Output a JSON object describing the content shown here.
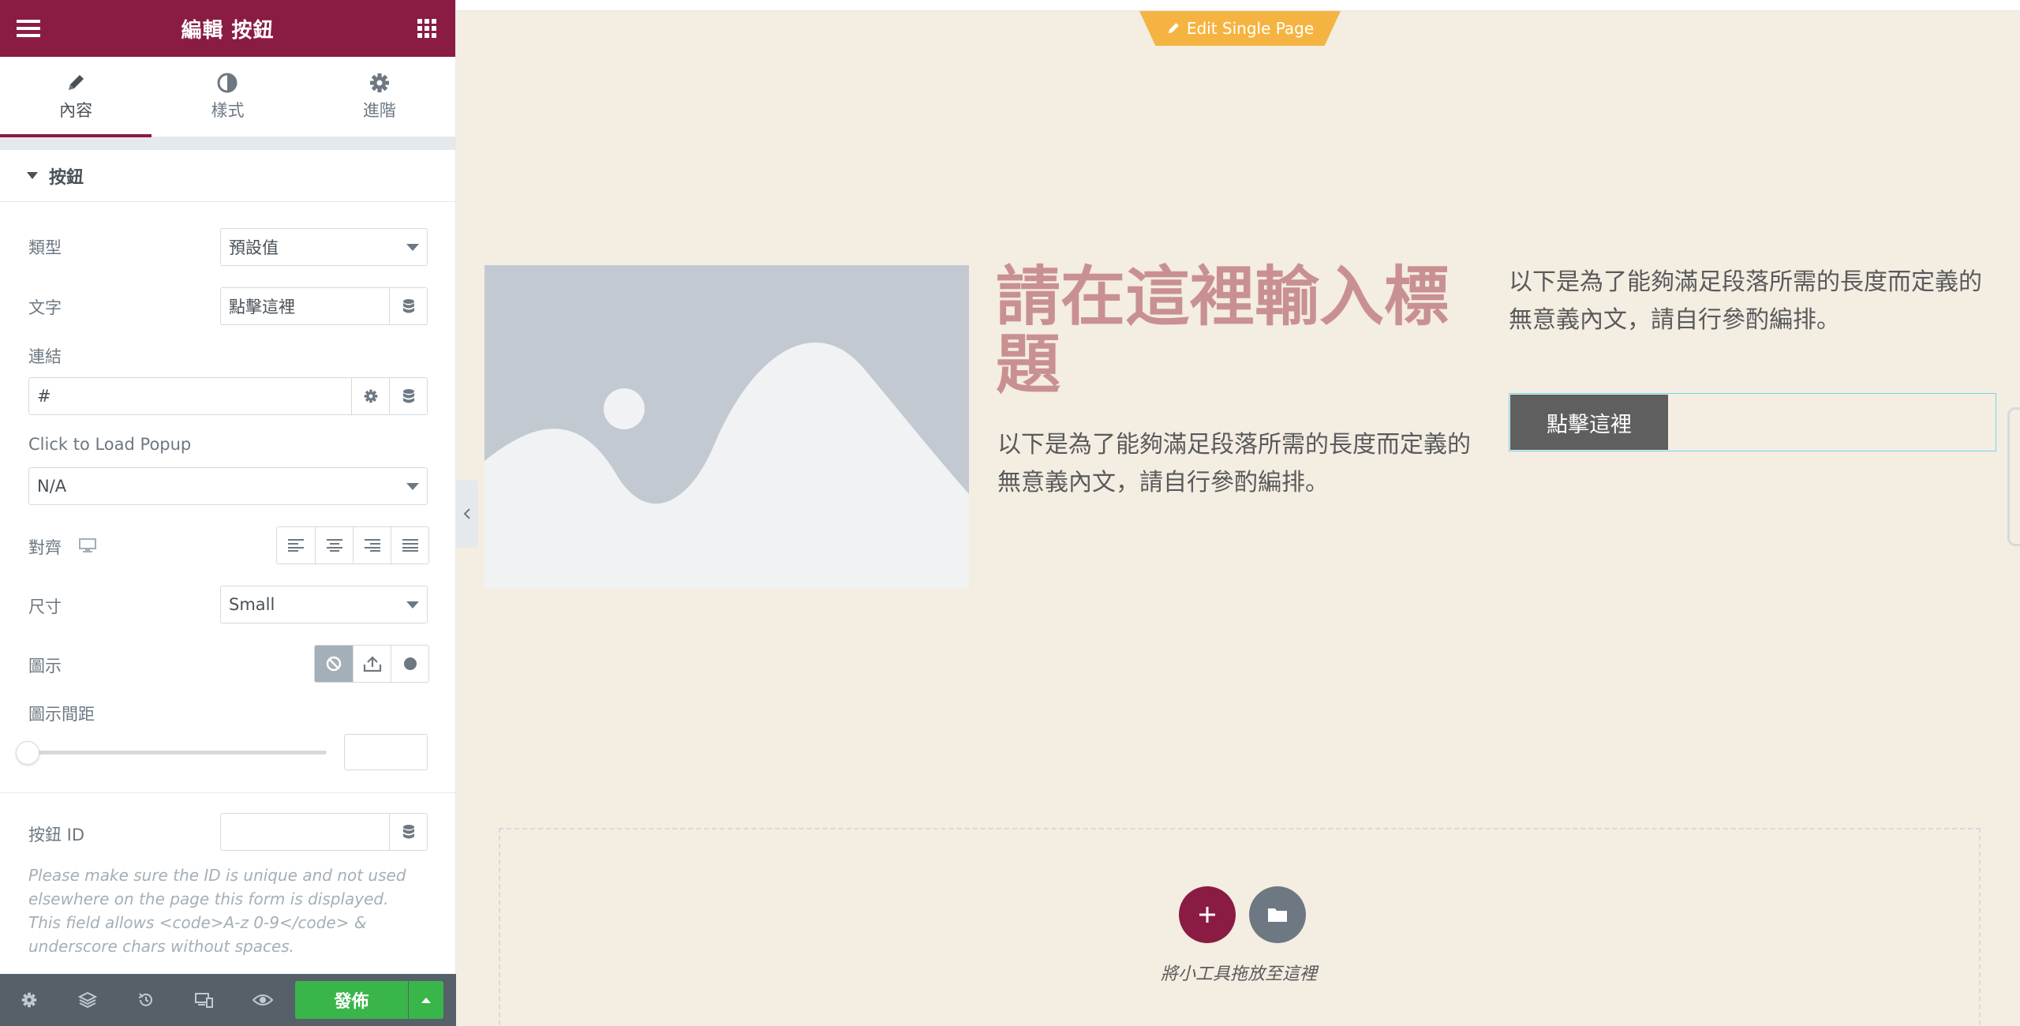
{
  "panel": {
    "title": "編輯 按鈕",
    "tabs": [
      {
        "label": "內容",
        "icon": "pencil-icon",
        "active": true
      },
      {
        "label": "樣式",
        "icon": "contrast-icon",
        "active": false
      },
      {
        "label": "進階",
        "icon": "gear-icon",
        "active": false
      }
    ],
    "section_title": "按鈕",
    "controls": {
      "type_label": "類型",
      "type_value": "預設值",
      "text_label": "文字",
      "text_value": "點擊這裡",
      "link_label": "連結",
      "link_value": "#",
      "popup_label": "Click to Load Popup",
      "popup_value": "N/A",
      "align_label": "對齊",
      "size_label": "尺寸",
      "size_value": "Small",
      "icon_label": "圖示",
      "icon_spacing_label": "圖示間距",
      "button_id_label": "按鈕 ID",
      "button_id_help": "Please make sure the ID is unique and not used elsewhere on the page this form is displayed. This field allows <code>A-z 0-9</code> & underscore chars without spaces."
    },
    "footer": {
      "publish_label": "發佈"
    }
  },
  "preview": {
    "edit_tab_label": "Edit Single Page",
    "heading": "請在這裡輸入標題",
    "paragraph_1": "以下是為了能夠滿足段落所需的長度而定義的無意義內文，請自行參酌編排。",
    "paragraph_2": "以下是為了能夠滿足段落所需的長度而定義的無意義內文，請自行參酌編排。",
    "button_label": "點擊這裡",
    "drop_text": "將小工具拖放至這裡"
  },
  "colors": {
    "brand": "#8a1c44",
    "publish": "#39b54a",
    "canvas": "#f4ede1",
    "heading": "#c99092",
    "cta": "#5f5f5f",
    "edit_tab": "#f5b441"
  }
}
